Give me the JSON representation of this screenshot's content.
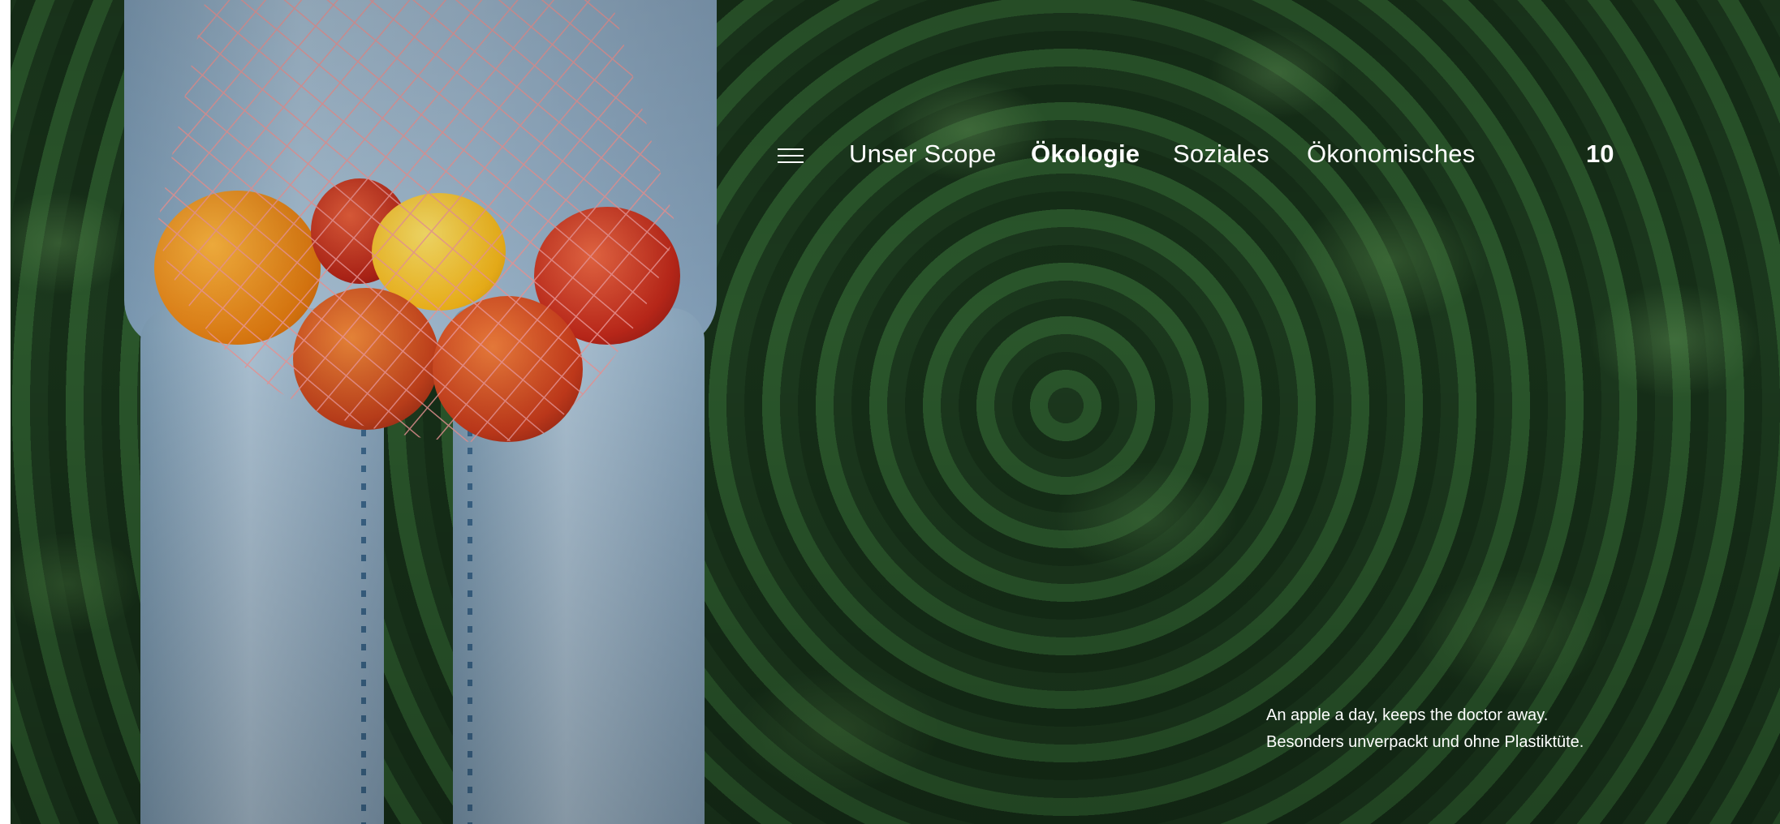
{
  "nav": {
    "menu_icon": "hamburger-menu-icon",
    "items": [
      {
        "label": "Unser Scope",
        "active": false
      },
      {
        "label": "Ökologie",
        "active": true
      },
      {
        "label": "Soziales",
        "active": false
      },
      {
        "label": "Ökonomisches",
        "active": false
      }
    ],
    "page_number": "10"
  },
  "caption": {
    "line1": "An apple a day, keeps the doctor away.",
    "line2": "Besonders unverpackt und ohne Plastiktüte."
  },
  "colors": {
    "text": "#ffffff",
    "foliage": "#1f4222",
    "denim": "#a9c2d6",
    "net": "#f08a8a"
  }
}
